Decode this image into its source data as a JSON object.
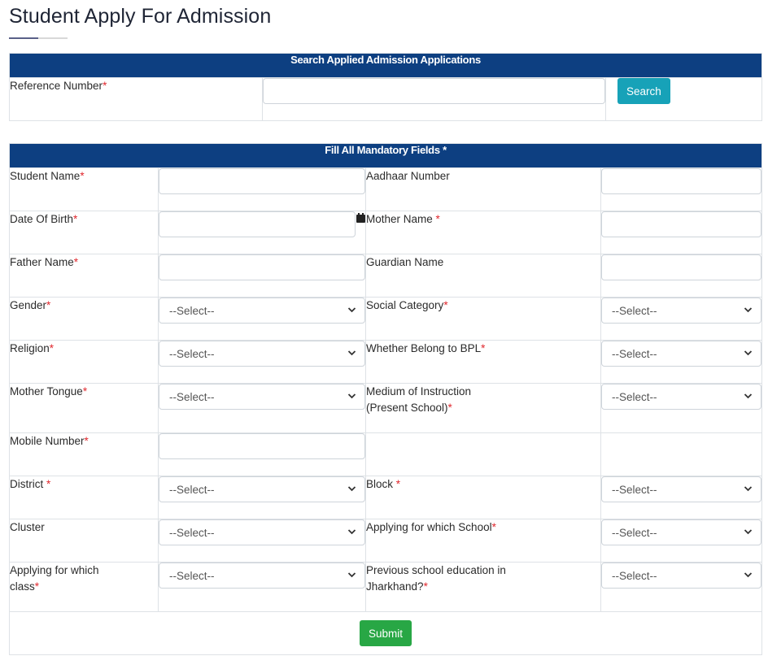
{
  "page": {
    "title": "Student Apply For Admission"
  },
  "search_section": {
    "header": "Search Applied Admission Applications",
    "reference_label": "Reference Number",
    "reference_value": "",
    "search_button": "Search"
  },
  "form_section": {
    "header": "Fill All Mandatory Fields *",
    "required_marker": "*",
    "select_placeholder": "--Select--",
    "fields": {
      "student_name": {
        "label": "Student Name",
        "required": true,
        "value": ""
      },
      "aadhaar_number": {
        "label": "Aadhaar Number",
        "required": false,
        "value": ""
      },
      "date_of_birth": {
        "label": "Date Of Birth",
        "required": true,
        "value": ""
      },
      "mother_name": {
        "label": "Mother Name ",
        "required": true,
        "value": ""
      },
      "father_name": {
        "label": "Father Name",
        "required": true,
        "value": ""
      },
      "guardian_name": {
        "label": "Guardian Name",
        "required": false,
        "value": ""
      },
      "gender": {
        "label": "Gender",
        "required": true,
        "selected": "--Select--"
      },
      "social_category": {
        "label": "Social Category",
        "required": true,
        "selected": "--Select--"
      },
      "religion": {
        "label": "Religion",
        "required": true,
        "selected": "--Select--"
      },
      "bpl": {
        "label": "Whether Belong to BPL",
        "required": true,
        "selected": "--Select--"
      },
      "mother_tongue": {
        "label": "Mother Tongue",
        "required": true,
        "selected": "--Select--"
      },
      "medium_of_instruction": {
        "label_line1": "Medium of Instruction",
        "label_line2": "(Present School)",
        "required": true,
        "selected": "--Select--"
      },
      "mobile_number": {
        "label": "Mobile Number",
        "required": true,
        "value": ""
      },
      "district": {
        "label": "District ",
        "required": true,
        "selected": "--Select--"
      },
      "block": {
        "label": "Block ",
        "required": true,
        "selected": "--Select--"
      },
      "cluster": {
        "label": "Cluster",
        "required": false,
        "selected": "--Select--"
      },
      "applying_school": {
        "label": "Applying for which School",
        "required": true,
        "selected": "--Select--"
      },
      "applying_class": {
        "label_line1": "Applying for which",
        "label_line2": "class",
        "required": true,
        "selected": "--Select--"
      },
      "previous_education": {
        "label_line1": "Previous school education in",
        "label_line2": "Jharkhand?",
        "required": true,
        "selected": "--Select--"
      }
    },
    "submit_button": "Submit"
  }
}
